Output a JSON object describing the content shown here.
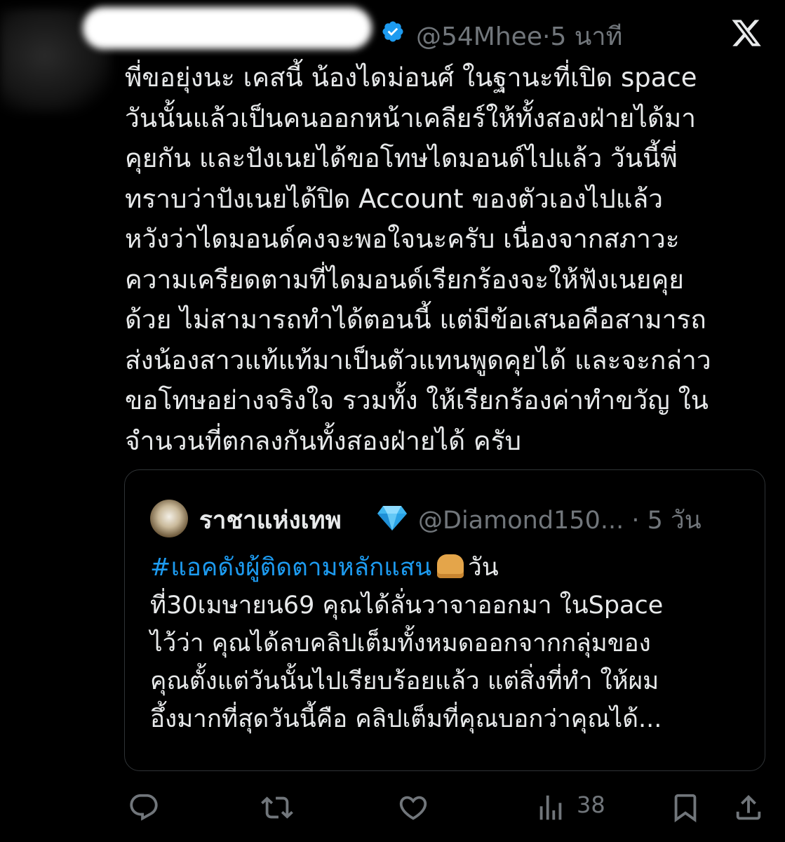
{
  "header": {
    "handle": "@54Mhee",
    "separator": "·",
    "time": "5 นาที",
    "brand_icon": "x-logo-icon",
    "verified_icon": "verified-badge-icon",
    "verified_color": "#1d9bf0"
  },
  "post": {
    "lines": [
      "พี่ขอยุ่งนะ  เคสนี้  น้องไดม่อนศ์  ในฐานะที่เปิด space",
      "วันนั้นแล้วเป็นคนออกหน้าเคลียร์ให้ทั้งสองฝ่ายได้มา",
      "คุยกัน  และปังเนยได้ขอโทษไดมอนด์ไปแล้ว    วันนี้พี่",
      "ทราบว่าปังเนยได้ปิด Account ของตัวเองไปแล้ว",
      "หวังว่าไดมอนด์คงจะพอใจนะครับ  เนื่องจากสภาวะ",
      "ความเครียดตามที่ไดมอนด์เรียกร้องจะให้ฟังเนยคุย",
      "ด้วย ไม่สามารถทำได้ตอนนี้   แต่มีข้อเสนอคือสามารถ",
      "ส่งน้องสาวแท้แท้มาเป็นตัวแทนพูดคุยได้ และจะกล่าว",
      "ขอโทษอย่างจริงใจ รวมทั้ง ให้เรียกร้องค่าทำขวัญ ใน",
      "จำนวนที่ตกลงกันทั้งสองฝ่ายได้  ครับ"
    ]
  },
  "quote": {
    "name": "ราชาแห่งเทพ",
    "badge_icon": "gem-icon",
    "handle": "@Diamond150...",
    "separator": "·",
    "time": "5 วัน",
    "hashtag": "#แอคดังผู้ติดตามหลักแสน",
    "hashtag_color": "#1d9bf0",
    "emoji_icon": "bread-icon",
    "first_line_rest": "วัน",
    "lines": [
      "ที่30เมษายน69 คุณได้ลั่นวาจาออกมา ในSpace",
      "ไว้ว่า คุณได้ลบคลิปเต็มทั้งหมดออกจากกลุ่มของ",
      "คุณตั้งแต่วันนั้นไปเรียบร้อยแล้ว แต่สิ่งที่ทำ ให้ผม",
      "อึ้งมากที่สุดวันนี้คือ คลิปเต็มที่คุณบอกว่าคุณได้..."
    ]
  },
  "actions": {
    "reply_icon": "reply-icon",
    "repost_icon": "repost-icon",
    "like_icon": "heart-icon",
    "views_icon": "views-icon",
    "views_count": "38",
    "bookmark_icon": "bookmark-icon",
    "share_icon": "share-icon",
    "icon_color": "#71767b"
  }
}
